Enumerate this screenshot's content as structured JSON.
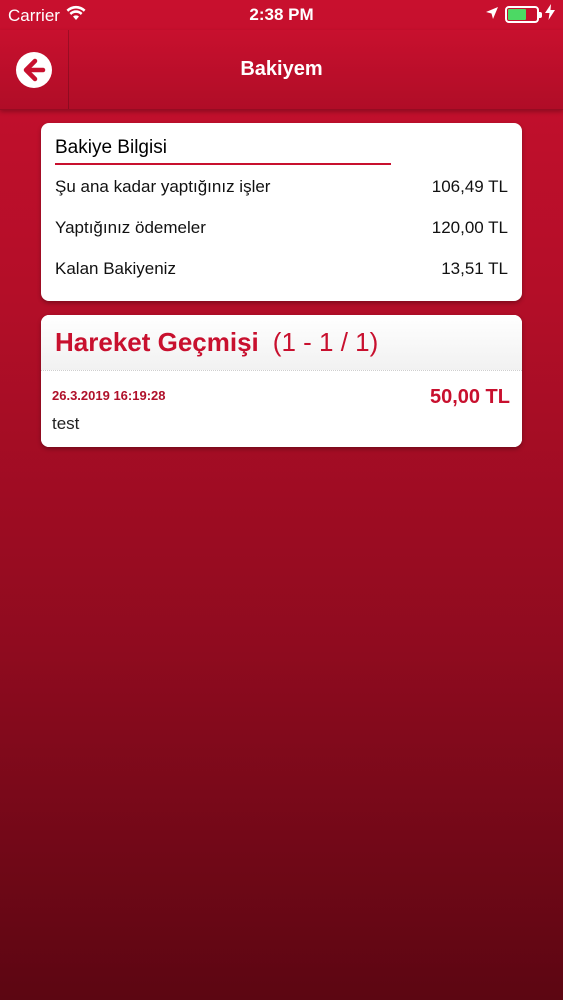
{
  "status_bar": {
    "carrier": "Carrier",
    "time": "2:38 PM",
    "battery_level": 0.65
  },
  "nav": {
    "title": "Bakiyem"
  },
  "balance": {
    "header": "Bakiye Bilgisi",
    "rows": [
      {
        "label": "Şu ana kadar yaptığınız işler",
        "value": "106,49 TL"
      },
      {
        "label": "Yaptığınız ödemeler",
        "value": "120,00 TL"
      },
      {
        "label": "Kalan Bakiyeniz",
        "value": "13,51 TL"
      }
    ]
  },
  "history": {
    "title": "Hareket Geçmişi",
    "count": "(1 - 1 / 1)",
    "items": [
      {
        "date": "26.3.2019 16:19:28",
        "amount": "50,00 TL",
        "description": "test"
      }
    ]
  },
  "colors": {
    "accent": "#c8102e",
    "battery": "#4cd964"
  }
}
